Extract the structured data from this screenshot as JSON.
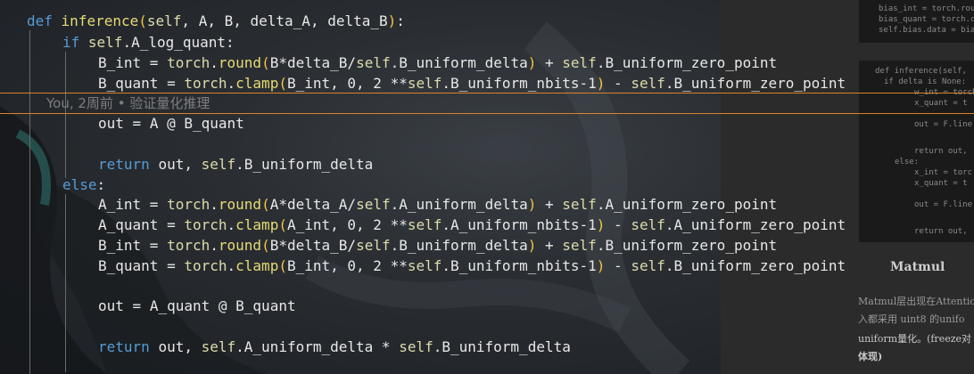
{
  "code_lines": [
    "def inference(self, A, B, delta_A, delta_B):",
    "if self.A_log_quant:",
    "B_int = torch.round(B*delta_B/self.B_uniform_delta) + self.B_uniform_zero_point",
    "B_quant = torch.clamp(B_int, 0, 2 **self.B_uniform_nbits-1) - self.B_uniform_zero_point",
    "out = A @ B_quant",
    "return out, self.B_uniform_delta",
    "else:",
    "A_int = torch.round(A*delta_A/self.A_uniform_delta) + self.A_uniform_zero_point",
    "A_quant = torch.clamp(A_int, 0, 2 **self.A_uniform_nbits-1) - self.A_uniform_zero_point",
    "B_int = torch.round(B*delta_B/self.B_uniform_delta) + self.B_uniform_zero_point",
    "B_quant = torch.clamp(B_int, 0, 2 **self.B_uniform_nbits-1) - self.B_uniform_zero_point",
    "out = A_quant @ B_quant",
    "return out, self.A_uniform_delta * self.B_uniform_delta"
  ],
  "blame": "You, 2周前 • 验证量化推理",
  "thumb_top_lines": [
    "bias_int = torch.round(",
    "bias_quant = torch.cl",
    "self.bias.data = bias_"
  ],
  "thumb_mid_lines": [
    "def inference(self,",
    "if delta is None:",
    "w_int = torch",
    "x_quant = t",
    "",
    "out = F.line",
    "",
    "return out,",
    "else:",
    "x_int = torc",
    "x_quant = t",
    "",
    "out = F.line",
    "",
    "return out,"
  ],
  "doc": {
    "heading": "Matmul",
    "line1": "Matmul层出现在Attention",
    "line2": "入都采用 uint8 的unifo",
    "line3": "uniform量化。(freeze对",
    "line4": "体现)"
  },
  "colors": {
    "keyword": "#569cd6",
    "function": "#e6db74",
    "builtin": "#dcdcaa",
    "paren": "#f4c542",
    "blame_border": "#d9822b"
  }
}
